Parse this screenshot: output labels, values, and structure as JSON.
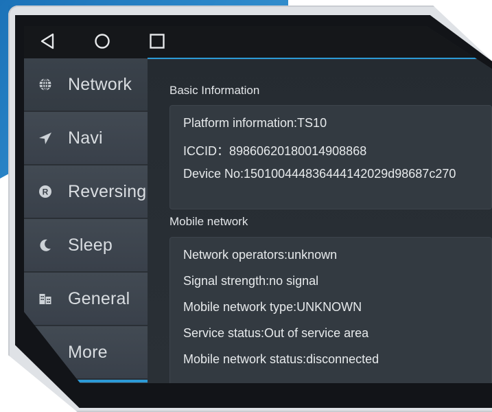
{
  "system_bar": {
    "back_icon": "back-triangle-icon",
    "home_icon": "home-circle-icon",
    "recents_icon": "recents-square-icon"
  },
  "sidebar": {
    "items": [
      {
        "label": "Network",
        "icon": "globe-icon"
      },
      {
        "label": "Navi",
        "icon": "navigation-arrow-icon"
      },
      {
        "label": "Reversing",
        "icon": "reverse-r-icon"
      },
      {
        "label": "Sleep",
        "icon": "moon-icon"
      },
      {
        "label": "General",
        "icon": "building-icon"
      },
      {
        "label": "More",
        "icon": "more-icon"
      }
    ]
  },
  "basic_info": {
    "title": "Basic Information",
    "platform": "Platform information:TS10",
    "iccid": "ICCID：89860620180014908868",
    "device_no": "Device No:150100444836444142029d98687c270"
  },
  "mobile_network": {
    "title": "Mobile network",
    "operators": "Network operators:unknown",
    "signal": "Signal strength:no signal",
    "type": "Mobile network type:UNKNOWN",
    "service": "Service status:Out of service area",
    "status": "Mobile network status:disconnected"
  },
  "colors": {
    "accent": "#2c9ad6",
    "sidebar_bg": "#3c434b",
    "content_bg": "#2a3036",
    "card_bg": "#333a41"
  }
}
